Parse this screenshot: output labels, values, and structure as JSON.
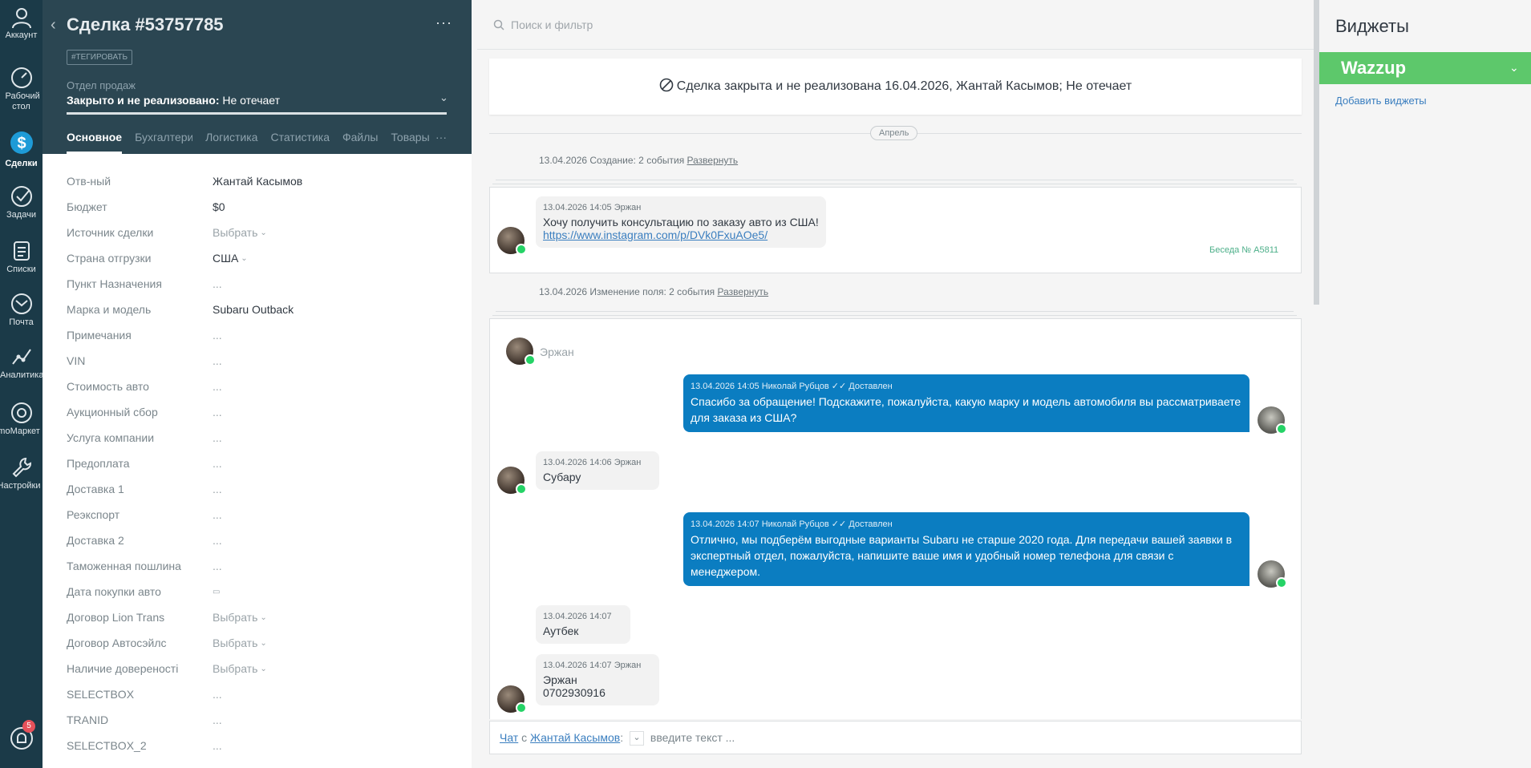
{
  "nav": {
    "items": [
      {
        "label": "Аккаунт"
      },
      {
        "label": "Рабочий стол"
      },
      {
        "label": "Сделки"
      },
      {
        "label": "Задачи"
      },
      {
        "label": "Списки"
      },
      {
        "label": "Почта"
      },
      {
        "label": "Аналитика"
      },
      {
        "label": "amoМаркет"
      },
      {
        "label": "Настройки"
      }
    ],
    "notifications_badge": "5"
  },
  "card": {
    "title": "Сделка #53757785",
    "more": "···",
    "tag_button": "#ТЕГИРОВАТЬ",
    "pipeline": "Отдел продаж",
    "status_bold": "Закрыто и не реализовано:",
    "status_reason": " Не отечает",
    "tabs": [
      {
        "label": "Основное"
      },
      {
        "label": "Бухгалтерия"
      },
      {
        "label": "Логистика"
      },
      {
        "label": "Статистика"
      },
      {
        "label": "Файлы"
      },
      {
        "label": "Товары"
      }
    ],
    "tabs_more": "···",
    "fields": [
      {
        "label": "Отв-ный",
        "value": "Жантай Касымов"
      },
      {
        "label": "Бюджет",
        "value": "$0"
      },
      {
        "label": "Источник сделки",
        "value": "Выбрать"
      },
      {
        "label": "Страна отгрузки",
        "value": "США"
      },
      {
        "label": "Пункт Назначения",
        "value": "..."
      },
      {
        "label": "Марка и модель",
        "value": "Subaru Outback"
      },
      {
        "label": "Примечания",
        "value": "..."
      },
      {
        "label": "VIN",
        "value": "..."
      },
      {
        "label": "Стоимость авто",
        "value": "..."
      },
      {
        "label": "Аукционный сбор",
        "value": "..."
      },
      {
        "label": "Услуга компании",
        "value": "..."
      },
      {
        "label": "Предоплата",
        "value": "..."
      },
      {
        "label": "Доставка 1",
        "value": "..."
      },
      {
        "label": "Реэкспорт",
        "value": "..."
      },
      {
        "label": "Доставка 2",
        "value": "..."
      },
      {
        "label": "Таможенная пошлина",
        "value": "..."
      },
      {
        "label": "Дата покупки авто",
        "value": ""
      },
      {
        "label": "Договор Lion Trans",
        "value": "Выбрать"
      },
      {
        "label": "Договор Автосэйлс",
        "value": "Выбрать"
      },
      {
        "label": "Наличие довереності",
        "value": "Выбрать"
      },
      {
        "label": "SELECTBOX",
        "value": "..."
      },
      {
        "label": "TRANID",
        "value": "..."
      },
      {
        "label": "SELECTBOX_2",
        "value": "..."
      }
    ]
  },
  "feed": {
    "search_placeholder": "Поиск и фильтр",
    "closed_banner": "Сделка закрыта и не реализована 16.04.2026, Жантай Касымов; Не отечает",
    "month": "Апрель",
    "event1": {
      "text": "13.04.2026 Создание: 2 события ",
      "link": "Развернуть"
    },
    "event2": {
      "text": "13.04.2026 Изменение поля: 2 события ",
      "link": "Развернуть"
    },
    "chat1": {
      "meta": "13.04.2026 14:05 Эржан",
      "text": "Хочу получить консультацию по заказу авто из США!",
      "link": "https://www.instagram.com/p/DVk0FxuAOe5/",
      "beseda": "Беседа № A5811"
    },
    "chat2_author": "Эржан",
    "messages": [
      {
        "meta": "13.04.2026 14:05 Николай Рубцов  ✓✓ Доставлен",
        "text": "Спасибо за обращение! Подскажите, пожалуйста, какую марку и модель автомобиля вы рассматриваете для заказа из США?"
      },
      {
        "meta": "13.04.2026 14:06 Эржан",
        "text": "Субару"
      },
      {
        "meta": "13.04.2026 14:07 Николай Рубцов  ✓✓ Доставлен",
        "text": "Отлично, мы подберём выгодные варианты Subaru не старше 2020 года. Для передачи вашей заявки в экспертный отдел, пожалуйста, напишите ваше имя и удобный номер телефона для связи с менеджером."
      },
      {
        "meta": "13.04.2026 14:07",
        "text": "Аутбек"
      },
      {
        "meta": "13.04.2026 14:07 Эржан",
        "text1": "Эржан",
        "text2": "0702930916"
      }
    ],
    "input": {
      "chat_link": "Чат",
      "with": " с ",
      "contact_link": "Жантай Касымов",
      "colon": ":",
      "placeholder": "введите текст ..."
    }
  },
  "widgets": {
    "title": "Виджеты",
    "wazzup": "Wazzup",
    "add_link": "Добавить виджеты"
  },
  "colors": {
    "nav_bg": "#1b3a48",
    "header_bg": "#2b4652",
    "out_bubble": "#0b7dc1",
    "wazzup_green": "#5dc86b",
    "whatsapp": "#25d366"
  }
}
